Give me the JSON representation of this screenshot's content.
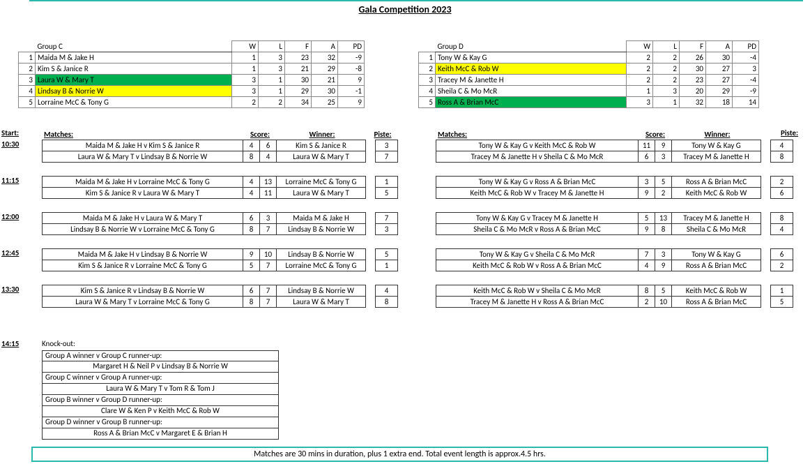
{
  "title": "Gala Competition 2023",
  "headers": {
    "W": "W",
    "L": "L",
    "F": "F",
    "A": "A",
    "PD": "PD"
  },
  "groupC": {
    "name": "Group C",
    "rows": [
      {
        "n": "1",
        "team": "Maida M & Jake H",
        "W": "1",
        "L": "3",
        "F": "23",
        "A": "32",
        "PD": "-9",
        "hl": ""
      },
      {
        "n": "2",
        "team": "Kim S & Janice R",
        "W": "1",
        "L": "3",
        "F": "21",
        "A": "29",
        "PD": "-8",
        "hl": ""
      },
      {
        "n": "3",
        "team": "Laura W & Mary T",
        "W": "3",
        "L": "1",
        "F": "30",
        "A": "21",
        "PD": "9",
        "hl": "green"
      },
      {
        "n": "4",
        "team": "Lindsay B & Norrie W",
        "W": "3",
        "L": "1",
        "F": "29",
        "A": "30",
        "PD": "-1",
        "hl": "yellow"
      },
      {
        "n": "5",
        "team": "Lorraine McC & Tony G",
        "W": "2",
        "L": "2",
        "F": "34",
        "A": "25",
        "PD": "9",
        "hl": ""
      }
    ]
  },
  "groupD": {
    "name": "Group D",
    "rows": [
      {
        "n": "1",
        "team": "Tony W & Kay G",
        "W": "2",
        "L": "2",
        "F": "26",
        "A": "30",
        "PD": "-4",
        "hl": ""
      },
      {
        "n": "2",
        "team": "Keith McC & Rob W",
        "W": "2",
        "L": "2",
        "F": "30",
        "A": "27",
        "PD": "3",
        "hl": "yellow"
      },
      {
        "n": "3",
        "team": "Tracey M & Janette H",
        "W": "2",
        "L": "2",
        "F": "23",
        "A": "27",
        "PD": "-4",
        "hl": ""
      },
      {
        "n": "4",
        "team": "Sheila C & Mo McR",
        "W": "1",
        "L": "3",
        "F": "20",
        "A": "29",
        "PD": "-9",
        "hl": ""
      },
      {
        "n": "5",
        "team": "Ross A & Brian McC",
        "W": "3",
        "L": "1",
        "F": "32",
        "A": "18",
        "PD": "14",
        "hl": "green"
      }
    ]
  },
  "mh": {
    "start": "Start:",
    "matches": "Matches:",
    "score": "Score:",
    "winner": "Winner:",
    "piste": "Piste:"
  },
  "times": {
    "t1": "10:30",
    "t2": "11:15",
    "t3": "12:00",
    "t4": "12:45",
    "t5": "13:30",
    "t6": "14:15"
  },
  "C_1030": [
    {
      "m": "Maida M & Jake H v Kim S & Janice R",
      "s1": "4",
      "s2": "6",
      "w": "Kim S & Janice R",
      "p": "3"
    },
    {
      "m": "Laura W & Mary T v Lindsay B & Norrie W",
      "s1": "8",
      "s2": "4",
      "w": "Laura W & Mary T",
      "p": "7"
    }
  ],
  "D_1030": [
    {
      "m": "Tony W & Kay G v Keith McC & Rob W",
      "s1": "11",
      "s2": "9",
      "w": "Tony W & Kay G",
      "p": "4"
    },
    {
      "m": "Tracey M & Janette H v Sheila C & Mo McR",
      "s1": "6",
      "s2": "3",
      "w": "Tracey M & Janette H",
      "p": "8"
    }
  ],
  "C_1115": [
    {
      "m": "Maida M & Jake H v Lorraine McC & Tony G",
      "s1": "4",
      "s2": "13",
      "w": "Lorraine McC & Tony G",
      "p": "1"
    },
    {
      "m": "Kim S & Janice R v Laura W & Mary T",
      "s1": "4",
      "s2": "11",
      "w": "Laura W & Mary T",
      "p": "5"
    }
  ],
  "D_1115": [
    {
      "m": "Tony W & Kay G v Ross A & Brian McC",
      "s1": "3",
      "s2": "5",
      "w": "Ross A & Brian McC",
      "p": "2"
    },
    {
      "m": "Keith McC & Rob W v Tracey M & Janette H",
      "s1": "9",
      "s2": "2",
      "w": "Keith McC & Rob W",
      "p": "6"
    }
  ],
  "C_1200": [
    {
      "m": "Maida M & Jake H v Laura W & Mary T",
      "s1": "6",
      "s2": "3",
      "w": "Maida M & Jake H",
      "p": "7"
    },
    {
      "m": "Lindsay B & Norrie W v Lorraine McC & Tony G",
      "s1": "8",
      "s2": "7",
      "w": "Lindsay B & Norrie W",
      "p": "3"
    }
  ],
  "D_1200": [
    {
      "m": "Tony W & Kay G v Tracey M & Janette H",
      "s1": "5",
      "s2": "13",
      "w": "Tracey M & Janette H",
      "p": "8"
    },
    {
      "m": "Sheila C & Mo McR v Ross A & Brian McC",
      "s1": "9",
      "s2": "8",
      "w": "Sheila C & Mo McR",
      "p": "4"
    }
  ],
  "C_1245": [
    {
      "m": "Maida M & Jake H v Lindsay B & Norrie W",
      "s1": "9",
      "s2": "10",
      "w": "Lindsay B & Norrie W",
      "p": "5"
    },
    {
      "m": "Kim S & Janice R v Lorraine McC & Tony G",
      "s1": "5",
      "s2": "7",
      "w": "Lorraine McC & Tony G",
      "p": "1"
    }
  ],
  "D_1245": [
    {
      "m": "Tony W & Kay G v Sheila C & Mo McR",
      "s1": "7",
      "s2": "3",
      "w": "Tony W & Kay G",
      "p": "6"
    },
    {
      "m": "Keith McC & Rob W v Ross A & Brian McC",
      "s1": "4",
      "s2": "9",
      "w": "Ross A & Brian McC",
      "p": "2"
    }
  ],
  "C_1330": [
    {
      "m": "Kim S & Janice R v Lindsay B & Norrie W",
      "s1": "6",
      "s2": "7",
      "w": "Lindsay B & Norrie W",
      "p": "4"
    },
    {
      "m": "Laura W & Mary T v Lorraine McC & Tony G",
      "s1": "8",
      "s2": "7",
      "w": "Laura W & Mary T",
      "p": "8"
    }
  ],
  "D_1330": [
    {
      "m": "Keith McC & Rob W v Sheila C & Mo McR",
      "s1": "8",
      "s2": "5",
      "w": "Keith McC & Rob W",
      "p": "1"
    },
    {
      "m": "Tracey M & Janette H v Ross A & Brian McC",
      "s1": "2",
      "s2": "10",
      "w": "Ross A & Brian McC",
      "p": "5"
    }
  ],
  "ko": {
    "title": "Knock-out:",
    "lines": [
      "Group A winner v Group C runner-up:",
      "Margaret H & Neil P  v  Lindsay B & Norrie W",
      "Group C winner v Group A runner-up:",
      "Laura W & Mary T  v  Tom R & Tom J",
      "Group B winner v Group D runner-up:",
      "Clare W & Ken P  v  Keith McC & Rob W",
      "Group D winner v Group B runner-up:",
      "Ross A & Brian McC  v  Margaret E & Brian H"
    ]
  },
  "footer": "Matches are 30 mins in duration, plus 1 extra end. Total event length is approx.4.5 hrs."
}
